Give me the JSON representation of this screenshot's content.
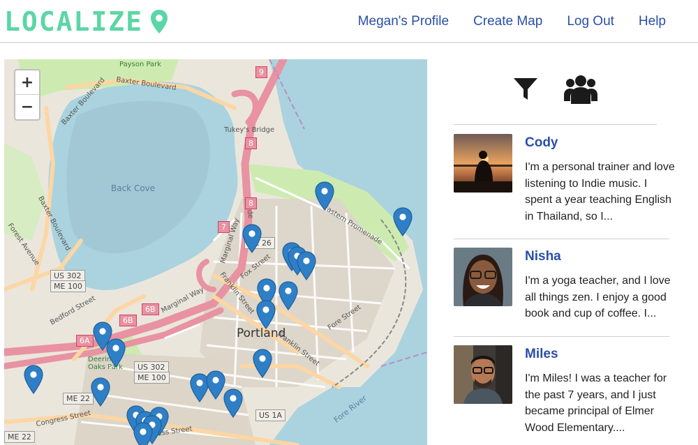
{
  "app": {
    "logo_text": "LOCALIZE",
    "brand_color": "#5bd6a6",
    "link_color": "#2a4fa8"
  },
  "nav": {
    "items": [
      {
        "label": "Megan's Profile"
      },
      {
        "label": "Create Map"
      },
      {
        "label": "Log Out"
      },
      {
        "label": "Help"
      }
    ]
  },
  "map": {
    "zoom_in": "+",
    "zoom_out": "−",
    "marker_color": "#2e7fc6",
    "labels": {
      "city": "Portland",
      "back_cove": "Back Cove",
      "tukeys_bridge": "Tukey's Bridge",
      "baxter_boulevard_1": "Baxter Boulevard",
      "baxter_boulevard_2": "Baxter Boulevard",
      "baxter_boulevard_3": "Baxter Boulevard",
      "forest_avenue": "Forest Avenue",
      "bedford_street": "Bedford Street",
      "marginal_way": "Marginal Way",
      "marginal_way_2": "Marginal Way",
      "franklin_street": "Franklin Street",
      "franklin_street_2": "Franklin Street",
      "fox_street": "Fox Street",
      "fore_street": "Fore Street",
      "fore_river": "Fore River",
      "congress_street": "Congress Street",
      "congress_street_2": "Congress Street",
      "eastern_promenade": "Eastern Promenade",
      "deering_oaks_park": "Deering Oaks Park",
      "payson_park": "Payson Park",
      "anderson": "Ande"
    },
    "shields": {
      "us302_a": "US 302",
      "me100_a": "ME 100",
      "us302_b": "US 302",
      "me100_b": "ME 100",
      "me22_a": "ME 22",
      "me22_b": "ME 22",
      "us1a": "US 1A",
      "me26": "ME 26",
      "r6a": "6A",
      "r6b": "6B",
      "r7": "7",
      "r8": "8",
      "r9": "9"
    }
  },
  "sidebar": {
    "filter_icon": "filter-icon",
    "group_icon": "users-icon",
    "people": [
      {
        "name": "Cody",
        "bio": "I'm a personal trainer and love listening to Indie music. I spent a year teaching English in Thailand, so I..."
      },
      {
        "name": "Nisha",
        "bio": "I'm a yoga teacher, and I love all things zen. I enjoy a good book and cup of coffee. I..."
      },
      {
        "name": "Miles",
        "bio": "I'm Miles! I was a teacher for the past 7 years, and I just became principal of Elmer Wood Elementary...."
      }
    ]
  }
}
